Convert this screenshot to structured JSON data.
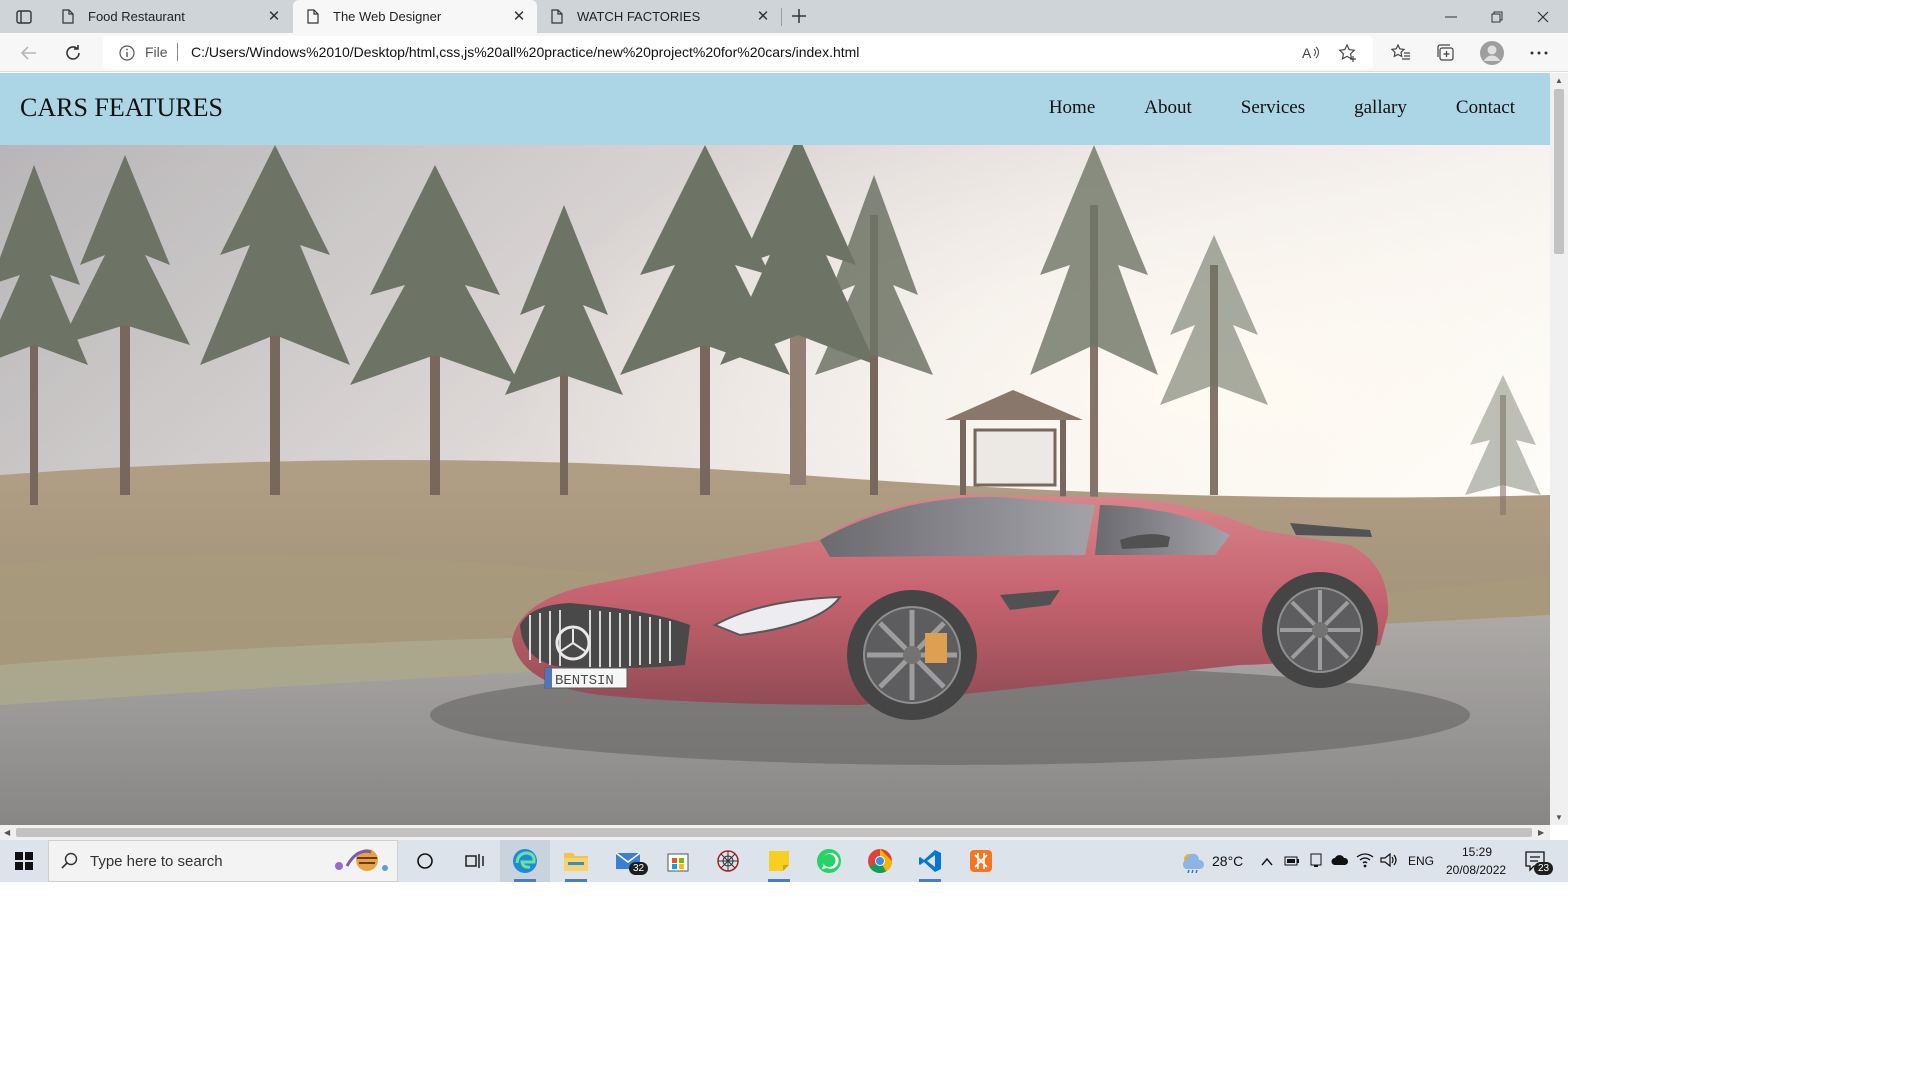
{
  "browser": {
    "tabs": [
      {
        "title": "Food Restaurant",
        "active": false
      },
      {
        "title": "The Web Designer",
        "active": true
      },
      {
        "title": "WATCH FACTORIES",
        "active": false
      }
    ],
    "address": {
      "scheme_label": "File",
      "url": "C:/Users/Windows%2010/Desktop/html,css,js%20all%20practice/new%20project%20for%20cars/index.html"
    }
  },
  "site": {
    "brand": "CARS FEATURES",
    "nav": [
      "Home",
      "About",
      "Services",
      "gallary",
      "Contact"
    ],
    "header_color": "#acd6e6",
    "hero": {
      "plate_text": "BENTSIN",
      "car_color": "#b8404f"
    }
  },
  "taskbar": {
    "search_placeholder": "Type here to search",
    "mail_badge": "32",
    "weather": "28°C",
    "language": "ENG",
    "time": "15:29",
    "date": "20/08/2022",
    "notifications": "23"
  }
}
